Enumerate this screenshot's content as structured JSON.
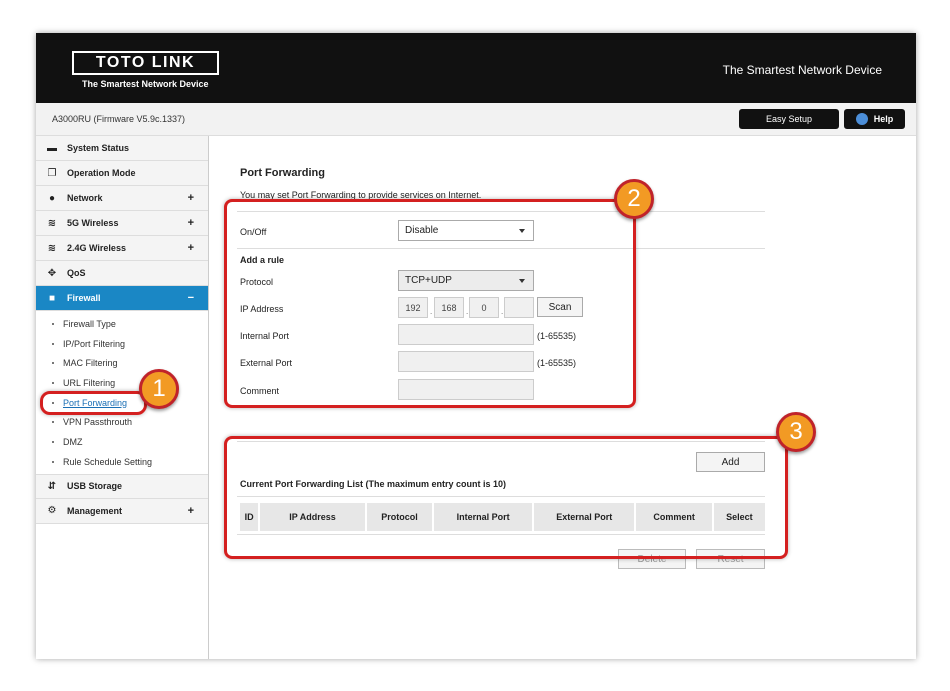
{
  "header": {
    "logo_text": "TOTO LINK",
    "logo_sub": "The Smartest Network Device",
    "tagline": "The Smartest Network Device"
  },
  "subbar": {
    "firmware": "A3000RU (Firmware V5.9c.1337)",
    "easy_setup": "Easy Setup",
    "help": "Help"
  },
  "sidebar": {
    "items": [
      {
        "label": "System Status",
        "icon": "chat-icon",
        "plus": ""
      },
      {
        "label": "Operation Mode",
        "icon": "monitor-icon",
        "plus": ""
      },
      {
        "label": "Network",
        "icon": "globe-icon",
        "plus": "+"
      },
      {
        "label": "5G Wireless",
        "icon": "wifi-icon",
        "plus": "+"
      },
      {
        "label": "2.4G Wireless",
        "icon": "wifi-icon",
        "plus": "+"
      },
      {
        "label": "QoS",
        "icon": "diamond-icon",
        "plus": ""
      },
      {
        "label": "Firewall",
        "icon": "lock-icon",
        "plus": "−"
      }
    ],
    "firewall_subitems": [
      "Firewall Type",
      "IP/Port Filtering",
      "MAC Filtering",
      "URL Filtering",
      "Port Forwarding",
      "VPN Passthrouth",
      "DMZ",
      "Rule Schedule Setting"
    ],
    "bottom_items": [
      {
        "label": "USB Storage",
        "icon": "usb-icon",
        "plus": ""
      },
      {
        "label": "Management",
        "icon": "gear-icon",
        "plus": "+"
      }
    ]
  },
  "main": {
    "title": "Port Forwarding",
    "description": "You may set Port Forwarding to provide services on Internet.",
    "onoff_label": "On/Off",
    "onoff_value": "Disable",
    "add_rule_label": "Add a rule",
    "protocol_label": "Protocol",
    "protocol_value": "TCP+UDP",
    "ip_label": "IP Address",
    "ip_octets": [
      "192",
      "168",
      "0",
      ""
    ],
    "scan_label": "Scan",
    "internal_port_label": "Internal Port",
    "external_port_label": "External Port",
    "range_hint": "(1-65535)",
    "comment_label": "Comment",
    "add_button": "Add",
    "list_title": "Current Port Forwarding List  (The maximum entry count is 10)",
    "columns": [
      "ID",
      "IP Address",
      "Protocol",
      "Internal Port",
      "External Port",
      "Comment",
      "Select"
    ],
    "delete_button": "Delete",
    "reset_button": "Reset"
  },
  "annotations": {
    "marker_1": "1",
    "marker_2": "2",
    "marker_3": "3",
    "color": "#d42020",
    "circle_color": "#f29a24"
  },
  "colors": {
    "header_bg": "#111111",
    "accent": "#1a87c5"
  }
}
